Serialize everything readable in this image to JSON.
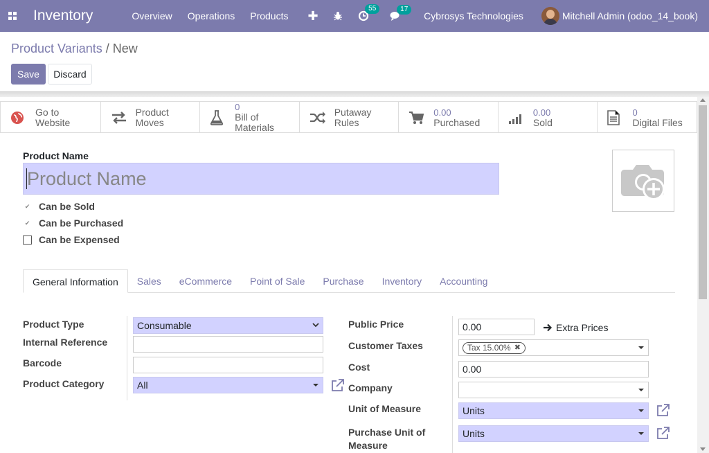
{
  "navbar": {
    "app_name": "Inventory",
    "menu": [
      "Overview",
      "Operations",
      "Products"
    ],
    "activity_badge": "55",
    "messages_badge": "17",
    "company": "Cybrosys Technologies",
    "user": "Mitchell Admin (odoo_14_book)"
  },
  "control_panel": {
    "breadcrumb_parent": "Product Variants",
    "breadcrumb_sep": "/",
    "breadcrumb_current": "New",
    "save_label": "Save",
    "discard_label": "Discard"
  },
  "button_box": [
    {
      "icon": "globe-icon",
      "value": "Go to",
      "label": "Website"
    },
    {
      "icon": "arrows-exchange-icon",
      "value": "",
      "label": "Product Moves"
    },
    {
      "icon": "flask-icon",
      "value": "0",
      "label": "Bill of Materials"
    },
    {
      "icon": "random-icon",
      "value": "",
      "label": "Putaway Rules"
    },
    {
      "icon": "shopping-cart-icon",
      "value": "0.00",
      "label": "Purchased"
    },
    {
      "icon": "signal-icon",
      "value": "0.00",
      "label": "Sold"
    },
    {
      "icon": "file-text-icon",
      "value": "0",
      "label": "Digital Files"
    }
  ],
  "form": {
    "product_name_label": "Product Name",
    "product_name_placeholder": "Product Name",
    "can_be_sold": "Can be Sold",
    "can_be_purchased": "Can be Purchased",
    "can_be_expensed": "Can be Expensed"
  },
  "tabs": [
    "General Information",
    "Sales",
    "eCommerce",
    "Point of Sale",
    "Purchase",
    "Inventory",
    "Accounting"
  ],
  "general_info": {
    "left": {
      "product_type_label": "Product Type",
      "product_type_value": "Consumable",
      "internal_reference_label": "Internal Reference",
      "internal_reference_value": "",
      "barcode_label": "Barcode",
      "barcode_value": "",
      "product_category_label": "Product Category",
      "product_category_value": "All"
    },
    "right": {
      "public_price_label": "Public Price",
      "public_price_value": "0.00",
      "extra_prices_label": "Extra Prices",
      "customer_taxes_label": "Customer Taxes",
      "customer_taxes_tag": "Tax 15.00%",
      "cost_label": "Cost",
      "cost_value": "0.00",
      "company_label": "Company",
      "company_value": "",
      "uom_label": "Unit of Measure",
      "uom_value": "Units",
      "purchase_uom_label_1": "Purchase Unit of",
      "purchase_uom_label_2": "Measure",
      "purchase_uom_value": "Units"
    }
  },
  "colors": {
    "navbar": "#7c7bad",
    "required_field": "#d2d2ff",
    "badge": "#00a09d"
  }
}
